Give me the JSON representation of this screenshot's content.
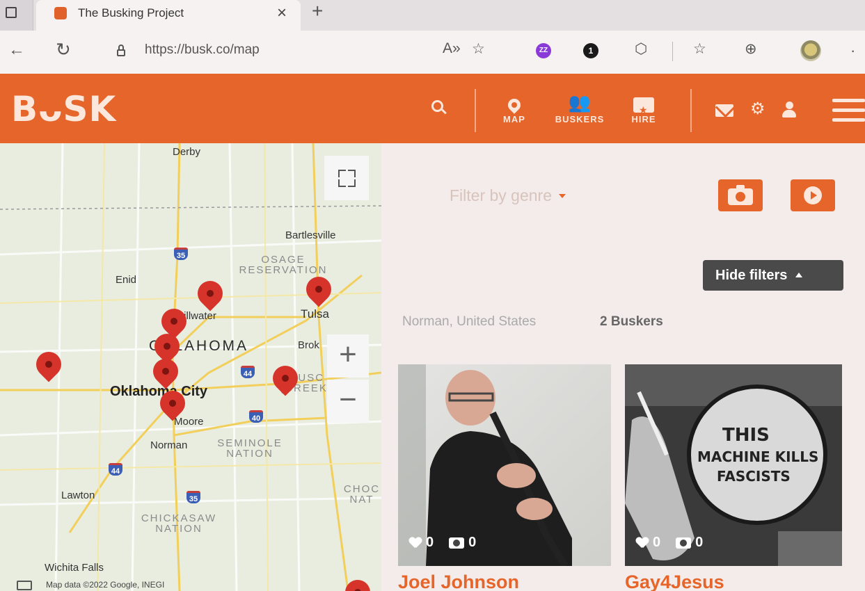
{
  "browser": {
    "tab_title": "The Busking Project",
    "tab_close": "×",
    "new_tab": "+",
    "url": "https://busk.co/map"
  },
  "header": {
    "logo": "BᴗSK",
    "nav": [
      {
        "label": "MAP",
        "icon": "map-pin-icon"
      },
      {
        "label": "BUSKERS",
        "icon": "buskers-group-icon"
      },
      {
        "label": "HIRE",
        "icon": "ticket-icon"
      }
    ],
    "icons": [
      "search-icon",
      "mail-icon",
      "gear-icon",
      "user-icon",
      "menu-icon"
    ]
  },
  "map": {
    "labels": {
      "derby": "Derby",
      "bartlesville": "Bartlesville",
      "osage": "OSAGE\nRESERVATION",
      "enid": "Enid",
      "stillwater": "Stillwater",
      "tulsa": "Tulsa",
      "oklahoma": "OKLAHOMA",
      "broken": "Brok",
      "okc": "Oklahoma City",
      "muscogee": "MUSC\n(CREEK)",
      "moore": "Moore",
      "norman": "Norman",
      "seminole": "SEMINOLE\nNATION",
      "lawton": "Lawton",
      "chickasaw": "CHICKASAW\nNATION",
      "choctaw": "CHOC\nNAT",
      "wichita": "Wichita Falls",
      "footer": "Map data ©2022 Google, INEGI"
    },
    "shields": {
      "i35a": "35",
      "i44a": "44",
      "i40": "40",
      "i44b": "44",
      "i35b": "35"
    },
    "controls": {
      "zoom_in": "+",
      "zoom_out": "−"
    }
  },
  "filters": {
    "genre_placeholder": "Filter by genre",
    "hide_filters": "Hide filters"
  },
  "results": {
    "location": "Norman, United States",
    "count": "2 Buskers",
    "buskers": [
      {
        "name": "Joel Johnson",
        "likes": "0",
        "photos": "0"
      },
      {
        "name": "Gay4Jesus",
        "likes": "0",
        "photos": "0"
      }
    ]
  },
  "colors": {
    "brand": "#e5652a",
    "dark": "#4a4a4a",
    "marker": "#d6342b"
  }
}
